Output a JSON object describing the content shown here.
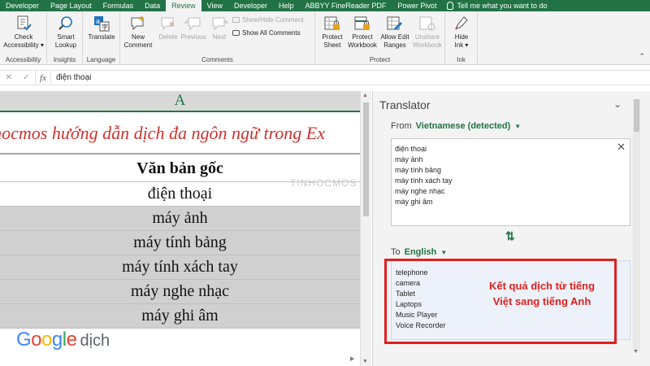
{
  "ribbon": {
    "tabs": [
      "Developer",
      "Page Layout",
      "Formulas",
      "Data",
      "Review",
      "View",
      "Developer",
      "Help",
      "ABBYY FineReader PDF",
      "Power Pivot"
    ],
    "active_tab": "Review",
    "tell_me": "Tell me what you want to do",
    "groups": {
      "accessibility": {
        "label": "Accessibility",
        "check": "Check\nAccessibility ▾"
      },
      "insights": {
        "label": "Insights",
        "smart_lookup": "Smart\nLookup"
      },
      "language": {
        "label": "Language",
        "translate": "Translate"
      },
      "comments": {
        "label": "Comments",
        "new_comment": "New\nComment",
        "delete": "Delete",
        "previous": "Previous",
        "next": "Next",
        "show_hide": "Show/Hide Comment",
        "show_all": "Show All Comments"
      },
      "protect": {
        "label": "Protect",
        "protect_sheet": "Protect\nSheet",
        "protect_workbook": "Protect\nWorkbook",
        "allow_edit": "Allow Edit\nRanges",
        "unshare": "Unshare\nWorkbook"
      },
      "ink": {
        "label": "Ink",
        "hide_ink": "Hide\nInk ▾"
      }
    }
  },
  "formula_bar": {
    "fx": "fx",
    "content": "điện thoại"
  },
  "sheet": {
    "column_header": "A",
    "title": "inhocmos hướng dẫn dịch đa ngôn ngữ trong Ex",
    "header": "Văn bản gốc",
    "rows": [
      "điện thoại",
      "máy ảnh",
      "máy tính bảng",
      "máy tính xách tay",
      "máy nghe nhạc",
      "máy ghi âm"
    ]
  },
  "logo": {
    "google": "Google",
    "dich": "dịch"
  },
  "translator": {
    "title": "Translator",
    "from_label": "From",
    "from_lang": "Vietnamese (detected)",
    "source_lines": [
      "điện thoại",
      "máy ảnh",
      "máy tính bảng",
      "máy tính xách tay",
      "máy nghe nhạc",
      "máy ghi âm"
    ],
    "to_label": "To",
    "to_lang": "English",
    "target_lines": [
      "telephone",
      "camera",
      "Tablet",
      "Laptops",
      "Music Player",
      "Voice Recorder"
    ]
  },
  "watermark": "TINHOCMOS",
  "annotation": "Kết quả dịch từ tiếng Việt sang tiếng Anh",
  "colors": {
    "excel_green": "#217346",
    "annotation_red": "#e02020",
    "title_red": "#d0312d"
  }
}
